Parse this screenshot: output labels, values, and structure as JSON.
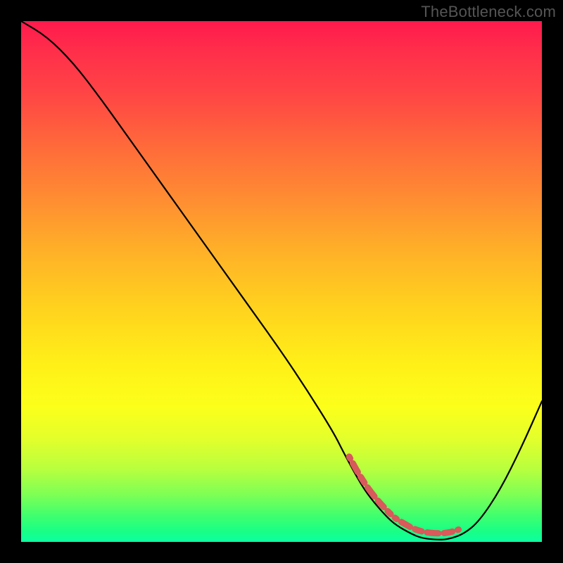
{
  "watermark": "TheBottleneck.com",
  "chart_data": {
    "type": "line",
    "title": "",
    "xlabel": "",
    "ylabel": "",
    "xlim": [
      0,
      100
    ],
    "ylim": [
      0,
      100
    ],
    "x": [
      0,
      5,
      10,
      15,
      20,
      25,
      30,
      35,
      40,
      45,
      50,
      55,
      60,
      62,
      65,
      67,
      70,
      72,
      75,
      77,
      80,
      82,
      85,
      88,
      92,
      96,
      100
    ],
    "values": [
      100,
      97,
      92,
      85.5,
      78.5,
      71.5,
      64.5,
      57.5,
      50.5,
      43.5,
      36.5,
      29,
      21,
      17,
      11.5,
      8.5,
      5,
      3.2,
      1.5,
      0.7,
      0.4,
      0.5,
      1.5,
      4,
      10,
      18,
      27
    ],
    "curve_color": "#000000",
    "highlight_segment": {
      "x_start": 63,
      "x_end": 85,
      "color": "#e06060"
    },
    "background_gradient": {
      "orientation": "vertical",
      "stops": [
        {
          "pos": 0.0,
          "color": "#ff1a4d"
        },
        {
          "pos": 0.14,
          "color": "#ff4545"
        },
        {
          "pos": 0.34,
          "color": "#ff8c32"
        },
        {
          "pos": 0.55,
          "color": "#ffd21e"
        },
        {
          "pos": 0.74,
          "color": "#fcff1a"
        },
        {
          "pos": 0.91,
          "color": "#7dff55"
        },
        {
          "pos": 1.0,
          "color": "#0cffa3"
        }
      ]
    }
  }
}
